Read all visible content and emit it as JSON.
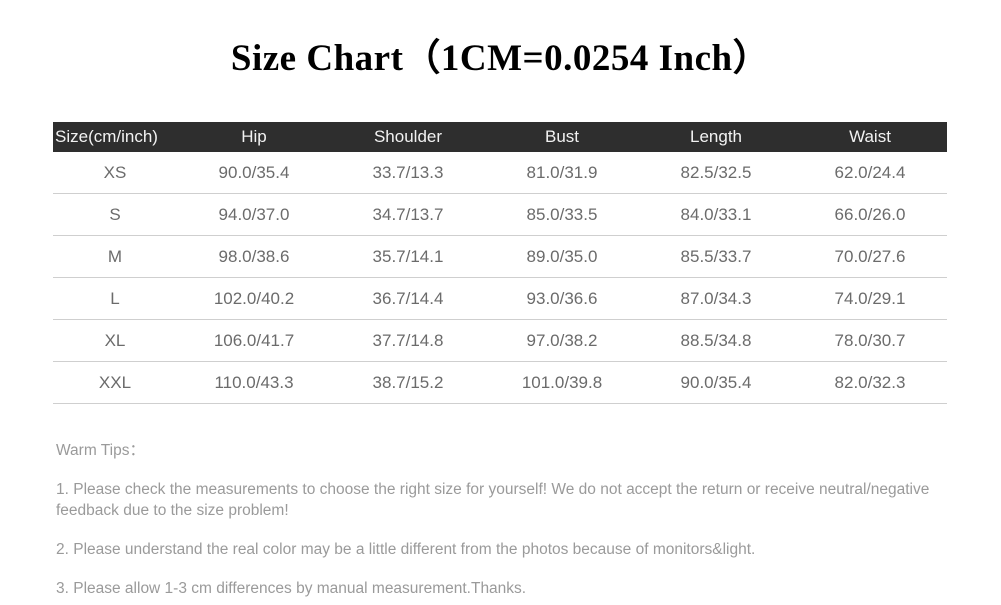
{
  "title": "Size Chart（1CM=0.0254 Inch）",
  "table": {
    "headers": [
      "Size(cm/inch)",
      "Hip",
      "Shoulder",
      "Bust",
      "Length",
      "Waist"
    ],
    "rows": [
      [
        "XS",
        "90.0/35.4",
        "33.7/13.3",
        "81.0/31.9",
        "82.5/32.5",
        "62.0/24.4"
      ],
      [
        "S",
        "94.0/37.0",
        "34.7/13.7",
        "85.0/33.5",
        "84.0/33.1",
        "66.0/26.0"
      ],
      [
        "M",
        "98.0/38.6",
        "35.7/14.1",
        "89.0/35.0",
        "85.5/33.7",
        "70.0/27.6"
      ],
      [
        "L",
        "102.0/40.2",
        "36.7/14.4",
        "93.0/36.6",
        "87.0/34.3",
        "74.0/29.1"
      ],
      [
        "XL",
        "106.0/41.7",
        "37.7/14.8",
        "97.0/38.2",
        "88.5/34.8",
        "78.0/30.7"
      ],
      [
        "XXL",
        "110.0/43.3",
        "38.7/15.2",
        "101.0/39.8",
        "90.0/35.4",
        "82.0/32.3"
      ]
    ]
  },
  "tips": {
    "heading": "Warm Tips：",
    "items": [
      "1. Please check the measurements to choose the right size for yourself! We do not accept the return or receive neutral/negative feedback due to the size problem!",
      "2. Please understand the real color may be a little different from the photos because of monitors&light.",
      "3. Please allow 1-3 cm differences by manual measurement.Thanks."
    ]
  },
  "colors": {
    "header_background": "#2e2e2e",
    "header_text": "#f2f2f2",
    "cell_text": "#6b6b6b",
    "rule": "#cfcfcf",
    "tips_text": "#9a9a9a",
    "title_text": "#000000",
    "page_background": "#ffffff"
  }
}
